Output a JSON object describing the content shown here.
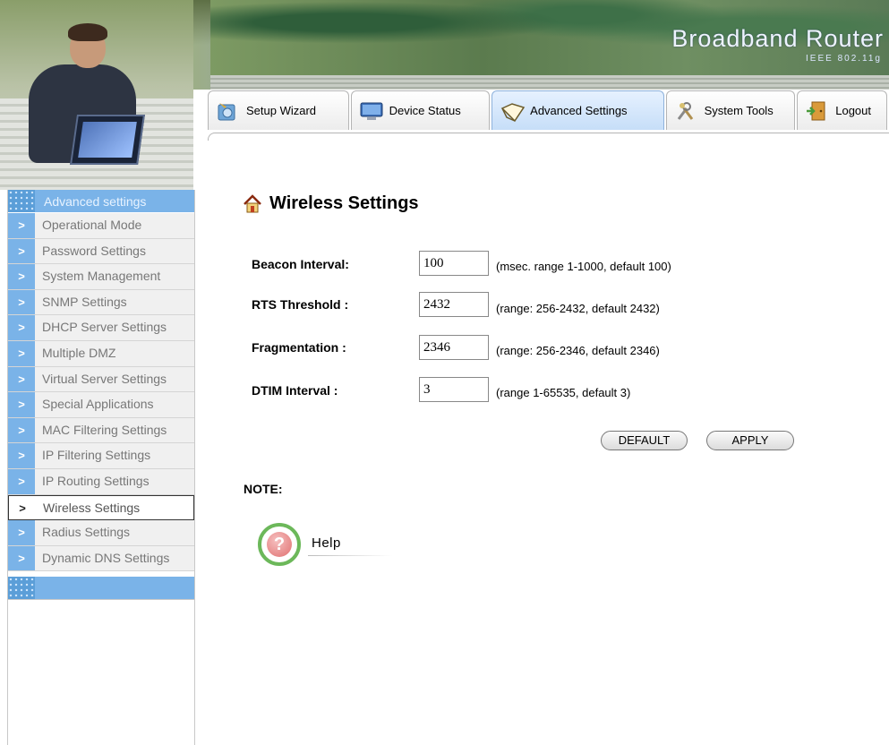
{
  "banner": {
    "brand": "Broadband Router",
    "subtitle": "IEEE 802.11g"
  },
  "tabs": [
    {
      "label": "Setup Wizard",
      "icon": "wizard-icon"
    },
    {
      "label": "Device Status",
      "icon": "monitor-icon"
    },
    {
      "label": "Advanced Settings",
      "icon": "book-icon",
      "active": true
    },
    {
      "label": "System Tools",
      "icon": "tools-icon"
    },
    {
      "label": "Logout",
      "icon": "logout-door-icon"
    }
  ],
  "sidebar": {
    "header": "Advanced settings",
    "items": [
      {
        "label": "Operational Mode"
      },
      {
        "label": "Password Settings"
      },
      {
        "label": "System Management"
      },
      {
        "label": "SNMP Settings"
      },
      {
        "label": "DHCP Server Settings"
      },
      {
        "label": "Multiple DMZ"
      },
      {
        "label": "Virtual Server Settings"
      },
      {
        "label": "Special Applications"
      },
      {
        "label": "MAC Filtering Settings"
      },
      {
        "label": "IP Filtering Settings"
      },
      {
        "label": "IP Routing Settings"
      },
      {
        "label": "Wireless Settings",
        "current": true
      },
      {
        "label": "Radius Settings"
      },
      {
        "label": "Dynamic DNS Settings"
      }
    ]
  },
  "main": {
    "title": "Wireless Settings",
    "fields": [
      {
        "label": "Beacon Interval:",
        "value": "100",
        "hint": "(msec. range 1-1000, default 100)"
      },
      {
        "label": "RTS Threshold :",
        "value": "2432",
        "hint": "(range: 256-2432, default 2432)"
      },
      {
        "label": "Fragmentation :",
        "value": "2346",
        "hint": "(range: 256-2346, default 2346)"
      },
      {
        "label": "DTIM Interval :",
        "value": "3",
        "hint": "(range 1-65535, default 3)"
      }
    ],
    "buttons": {
      "default_label": "DEFAULT",
      "apply_label": "APPLY"
    },
    "note_label": "NOTE:",
    "help_label": "Help"
  },
  "colors": {
    "sidebar_accent": "#7ab3e8",
    "help_ring": "#6cb85a"
  }
}
